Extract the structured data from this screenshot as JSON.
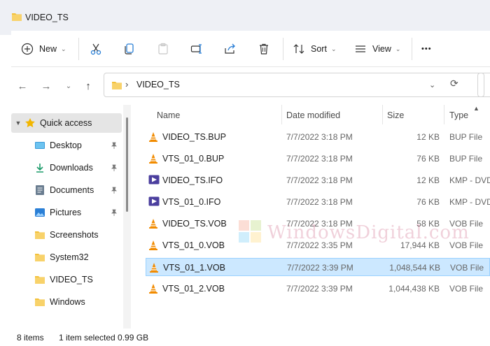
{
  "window": {
    "title": "VIDEO_TS"
  },
  "toolbar": {
    "new_label": "New",
    "sort_label": "Sort",
    "view_label": "View",
    "more_label": "•••"
  },
  "address": {
    "path_folder": "VIDEO_TS",
    "separator": "›"
  },
  "sidebar": {
    "items": [
      {
        "label": "Quick access",
        "icon": "star-icon"
      },
      {
        "label": "Desktop",
        "icon": "desktop-icon"
      },
      {
        "label": "Downloads",
        "icon": "download-icon"
      },
      {
        "label": "Documents",
        "icon": "document-icon"
      },
      {
        "label": "Pictures",
        "icon": "picture-icon"
      },
      {
        "label": "Screenshots",
        "icon": "folder-icon"
      },
      {
        "label": "System32",
        "icon": "folder-icon"
      },
      {
        "label": "VIDEO_TS",
        "icon": "folder-icon"
      },
      {
        "label": "Windows",
        "icon": "folder-icon"
      }
    ]
  },
  "columns": {
    "name": "Name",
    "date": "Date modified",
    "size": "Size",
    "type": "Type"
  },
  "files": [
    {
      "name": "VIDEO_TS.BUP",
      "date": "7/7/2022 3:18 PM",
      "size": "12 KB",
      "type": "BUP File",
      "icon": "vlc-cone-icon"
    },
    {
      "name": "VTS_01_0.BUP",
      "date": "7/7/2022 3:18 PM",
      "size": "76 KB",
      "type": "BUP File",
      "icon": "vlc-cone-icon"
    },
    {
      "name": "VIDEO_TS.IFO",
      "date": "7/7/2022 3:18 PM",
      "size": "12 KB",
      "type": "KMP - DVD",
      "icon": "kmp-play-icon"
    },
    {
      "name": "VTS_01_0.IFO",
      "date": "7/7/2022 3:18 PM",
      "size": "76 KB",
      "type": "KMP - DVD",
      "icon": "kmp-play-icon"
    },
    {
      "name": "VIDEO_TS.VOB",
      "date": "7/7/2022 3:18 PM",
      "size": "58 KB",
      "type": "VOB File",
      "icon": "vlc-cone-icon"
    },
    {
      "name": "VTS_01_0.VOB",
      "date": "7/7/2022 3:35 PM",
      "size": "17,944 KB",
      "type": "VOB File",
      "icon": "vlc-cone-icon"
    },
    {
      "name": "VTS_01_1.VOB",
      "date": "7/7/2022 3:39 PM",
      "size": "1,048,544 KB",
      "type": "VOB File",
      "icon": "vlc-cone-icon"
    },
    {
      "name": "VTS_01_2.VOB",
      "date": "7/7/2022 3:39 PM",
      "size": "1,044,438 KB",
      "type": "VOB File",
      "icon": "vlc-cone-icon"
    }
  ],
  "watermark": {
    "text": "WindowsDigital.com"
  },
  "status": {
    "count": "8 items",
    "selection": "1 item selected  0.99 GB"
  },
  "colors": {
    "accent": "#0067c0",
    "selection": "#cce8ff",
    "folder": "#f3c13a",
    "vlc": "#f18b00",
    "kmp": "#4b3f9e"
  }
}
